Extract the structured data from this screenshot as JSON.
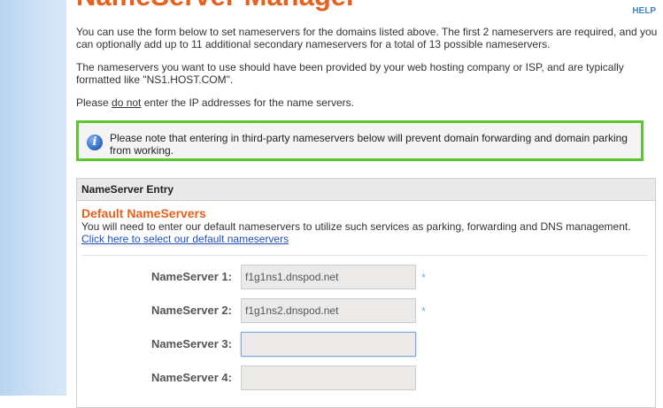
{
  "title": "NameServer Manager",
  "help_label": "HELP",
  "intro": {
    "p1": "You can use the form below to set nameservers for the domains listed above. The first 2 nameservers are required, and you can optionally add up to 11 additional secondary nameservers for a total of 13 possible nameservers.",
    "p2": "The nameservers you want to use should have been provided by your web hosting company or ISP, and are typically formatted like \"NS1.HOST.COM\".",
    "p3_before": "Please ",
    "p3_underline": "do not",
    "p3_after": " enter the IP addresses for the name servers."
  },
  "notice": {
    "icon": "info-icon",
    "text": "Please note that entering in third-party nameservers below will prevent domain forwarding and domain parking from working."
  },
  "panel": {
    "header": "NameServer Entry",
    "section_title": "Default NameServers",
    "section_desc": "You will need to enter our default nameservers to utilize such services as parking, forwarding and DNS management.",
    "section_link": "Click here to select our default nameservers"
  },
  "nameservers": [
    {
      "label": "NameServer 1:",
      "value": "f1g1ns1.dnspod.net",
      "required": "*"
    },
    {
      "label": "NameServer 2:",
      "value": "f1g1ns2.dnspod.net",
      "required": "*"
    },
    {
      "label": "NameServer 3:",
      "value": ""
    },
    {
      "label": "NameServer 4:",
      "value": ""
    }
  ],
  "colors": {
    "accent_orange": "#e8601e",
    "help_blue": "#3d86c6",
    "notice_border": "#5cc531",
    "link_blue": "#1f4fb4"
  }
}
